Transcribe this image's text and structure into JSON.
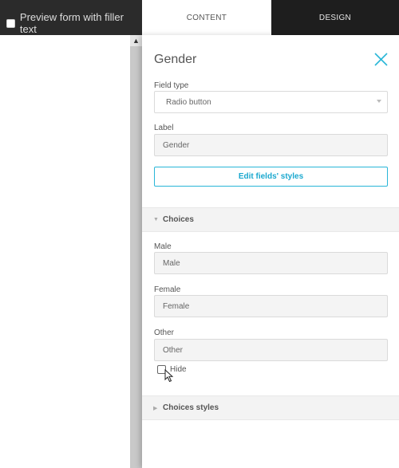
{
  "preview": {
    "label": "Preview form with filler text",
    "checked": false
  },
  "tabs": {
    "content": "CONTENT",
    "design": "DESIGN",
    "active": "CONTENT"
  },
  "panel": {
    "title": "Gender",
    "field_type": {
      "label": "Field type",
      "value": "Radio button"
    },
    "label_field": {
      "label": "Label",
      "value": "Gender"
    },
    "edit_styles_button": "Edit fields' styles",
    "choices_section": {
      "title": "Choices",
      "expanded": true,
      "items": [
        {
          "label": "Male",
          "value": "Male"
        },
        {
          "label": "Female",
          "value": "Female"
        },
        {
          "label": "Other",
          "value": "Other"
        }
      ],
      "hide_label": "Hide",
      "hide_checked": false
    },
    "choices_styles_section": {
      "title": "Choices styles",
      "expanded": false
    }
  },
  "colors": {
    "accent": "#29b6d8",
    "top_bar": "#2b2b2b",
    "design_tab": "#1e1e1e"
  }
}
